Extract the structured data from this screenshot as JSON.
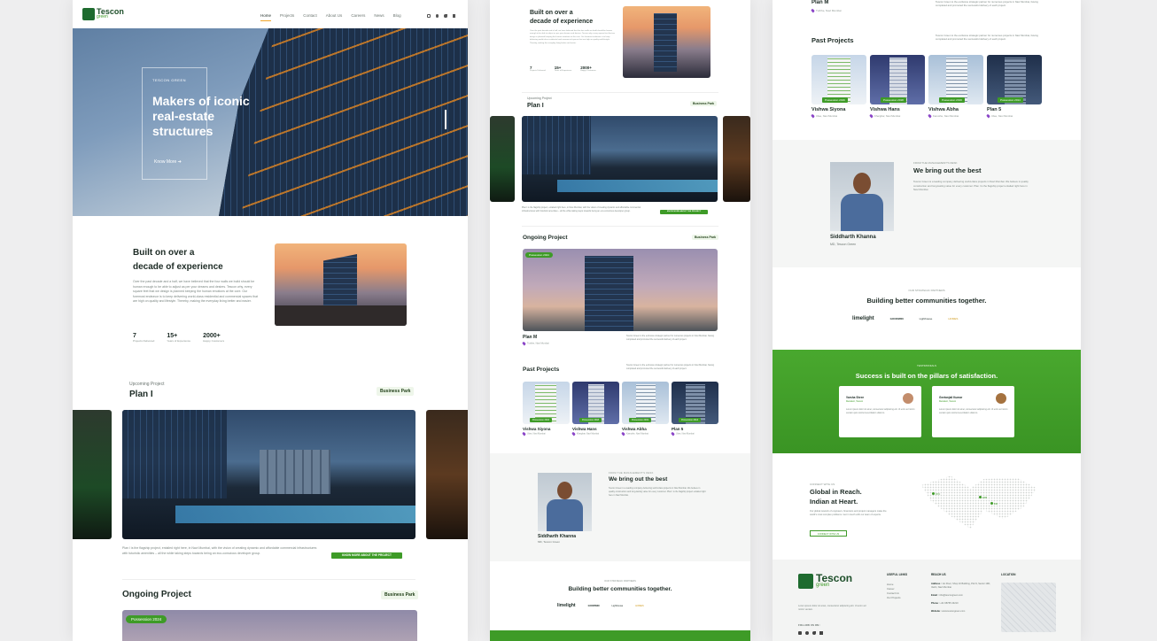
{
  "nav": {
    "logo_main": "Tescon",
    "logo_sub": "green",
    "tagline": "Building a sustainable tomorrow",
    "items": [
      "Home",
      "Projects",
      "Contact",
      "About Us",
      "Careers",
      "News",
      "Blog"
    ]
  },
  "hero": {
    "eyebrow": "TESCON GREEN",
    "title": "Makers of iconic real-estate structures",
    "cta": "Know More"
  },
  "about": {
    "title_line1": "Built on over a",
    "title_line2": "decade of experience",
    "body": "Over the past decade and a half, we have believed that the four walls we build should be human enough to be able to adjust as per your dreams and desires. Tescon why, every square feet that we design is planned keeping the human emotions at the core. Our foremost endeavor is to keep delivering world-class residential and commercial spaces that are high on quality and lifestyle. Thereby, making the everyday living better and easier.",
    "stats": [
      {
        "value": "7",
        "label": "Projects Delivered"
      },
      {
        "value": "15+",
        "label": "Years of Experience"
      },
      {
        "value": "2000+",
        "label": "Happy Customers"
      }
    ]
  },
  "upcoming": {
    "eyebrow": "Upcoming Project",
    "title": "Plan I",
    "tag": "Business Park",
    "body": "Plan I is the flagship project, entailed right here, in Navi Mumbai, with the vision of creating dynamic and affordable commercial infrastructures with futuristic amenities – all the while taking steps towards being an eco-conscious developer group.",
    "cta": "KNOW MORE ABOUT THE PROJECT"
  },
  "ongoing": {
    "title": "Ongoing Project",
    "tag": "Business Park",
    "badge": "Possession 2024",
    "name": "Plan M",
    "location": "Turbhe, Navi Mumbai",
    "body": "Tescon Green is the exclusive strategic partner for numerous projects in Navi Mumbai, having completed and promoted the successful delivery of each project."
  },
  "past": {
    "title": "Past Projects",
    "body": "Tescon Green is the exclusive strategic partner for numerous projects in Navi Mumbai, having completed and promoted the successful delivery of each project.",
    "items": [
      {
        "name": "Vishwa Siyona",
        "badge": "Possession 2016",
        "loc": "Ulwe, Navi Mumbai"
      },
      {
        "name": "Vishwa Hans",
        "badge": "Possession 2018",
        "loc": "Kharghar, Navi Mumbai"
      },
      {
        "name": "Vishwa Abha",
        "badge": "Possession 2019",
        "loc": "Kamothe, Navi Mumbai"
      },
      {
        "name": "Plan 5",
        "badge": "Possession 2014",
        "loc": "Ulwe, Navi Mumbai"
      }
    ]
  },
  "leader": {
    "eyebrow": "FROM THE MANAGEMENT'S DESK",
    "title": "We bring out the best",
    "name": "Siddharth Khanna",
    "role": "MD, Tescon Green",
    "body": "Tescon Green is a leading company delivering world-class projects in Navi Mumbai. We believe in quality construction and long-lasting value for every customer. Plan I is the flagship project entailed right here in Navi Mumbai."
  },
  "partners": {
    "eyebrow": "OUR STRATEGIC PARTNERS",
    "title": "Building better communities together.",
    "logos": [
      "limelight",
      "GOODWIN",
      "Lighthouse",
      "HOMES"
    ]
  },
  "testimonials": {
    "eyebrow": "TESTIMONIALS",
    "title": "Success is built on the pillars of satisfaction.",
    "items": [
      {
        "name": "Varsha Shree",
        "role": "Resident, Tescon",
        "text": "Lorem ipsum dolor sit amet, consectetur adipiscing elit. Ut enim ad minim veniam quis nostrud exercitation ullamco."
      },
      {
        "name": "Geetanjali Kumar",
        "role": "Resident, Tescon",
        "text": "Lorem ipsum dolor sit amet, consectetur adipiscing elit. Ut enim ad minim veniam quis nostrud exercitation ullamco."
      }
    ]
  },
  "global": {
    "eyebrow": "CONNECT WITH US",
    "title_line1": "Global in Reach.",
    "title_line2": "Indian at Heart.",
    "body": "Our global network of engineers, financiers and project managers make the world's most complex problems. Get in touch with our team of experts.",
    "cta": "CONNECT WITH US",
    "markers": [
      "NYC",
      "DXB",
      "IND"
    ]
  },
  "footer": {
    "useful_links": "USEFUL LINKS",
    "links": [
      "Home",
      "Career",
      "Contact Us",
      "Our Projects"
    ],
    "reach": "REACH US",
    "address_label": "Address :",
    "address": "1st Floor, Shop 10 Building, Plot 9, Sector 19D, Vashi, Navi Mumbai",
    "email_label": "Email :",
    "email": "info@tescongreen.com",
    "phone_label": "Phone :",
    "phone": "+91 98765 43210",
    "website_label": "Website :",
    "website": "www.tescongreen.com",
    "location": "LOCATION",
    "follow": "FOLLOW US ON :",
    "copyright": "Lorem ipsum dolor sit amet, consectetur adipiscing elit. Ut enim ad minim veniam."
  }
}
